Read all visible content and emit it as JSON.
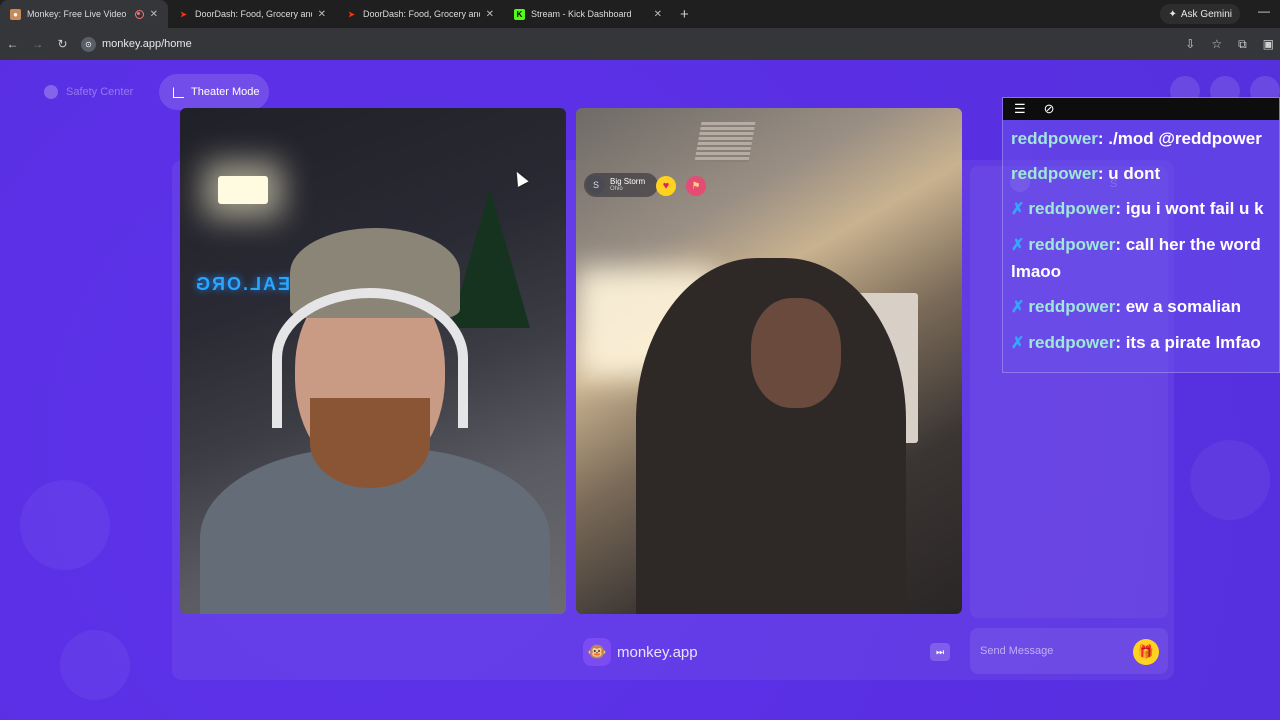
{
  "browser": {
    "tabs": [
      {
        "title": "Monkey: Free Live Video Ch",
        "active": true,
        "favicon": "monkey-icon",
        "color": "#c78a5a",
        "recording": true
      },
      {
        "title": "DoorDash: Food, Grocery and F",
        "active": false,
        "favicon": "doordash-icon",
        "color": "#ff3008"
      },
      {
        "title": "DoorDash: Food, Grocery and F",
        "active": false,
        "favicon": "doordash-icon",
        "color": "#ff3008"
      },
      {
        "title": "Stream - Kick Dashboard",
        "active": false,
        "favicon": "kick-icon",
        "color": "#53fc18"
      }
    ],
    "new_tab": "+",
    "ask_gemini": "Ask Gemini",
    "url": "monkey.app/home"
  },
  "page": {
    "safety_center": "Safety Center",
    "theater_mode": "Theater Mode",
    "right_video": {
      "user_initial": "S",
      "user_name": "Big Storm",
      "user_location": "Ohio"
    },
    "brand_logo_glyph": "🐵",
    "brand_text": "monkey.app",
    "send_placeholder": "Send Message",
    "gift_glyph": "🎁",
    "ghost_initial": "S"
  },
  "webcam": {
    "neon_sign": "TEAL.ORG"
  },
  "chat_overlay": {
    "messages": [
      {
        "user": "reddpower",
        "text": " ./mod @reddpower",
        "badge": false
      },
      {
        "user": "reddpower",
        "text": " u dont",
        "badge": false
      },
      {
        "user": "reddpower",
        "text": " igu i wont fail u k",
        "badge": true
      },
      {
        "user": "reddpower",
        "text": " call her the word lmaoo",
        "badge": true
      },
      {
        "user": "reddpower",
        "text": " ew a somalian",
        "badge": true
      },
      {
        "user": "reddpower",
        "text": " its a pirate lmfao",
        "badge": true
      }
    ]
  },
  "colors": {
    "page_bg": "#5b30e6",
    "username": "#9fe7d9",
    "badge": "#37a6ff",
    "gift": "#ffd21f"
  }
}
